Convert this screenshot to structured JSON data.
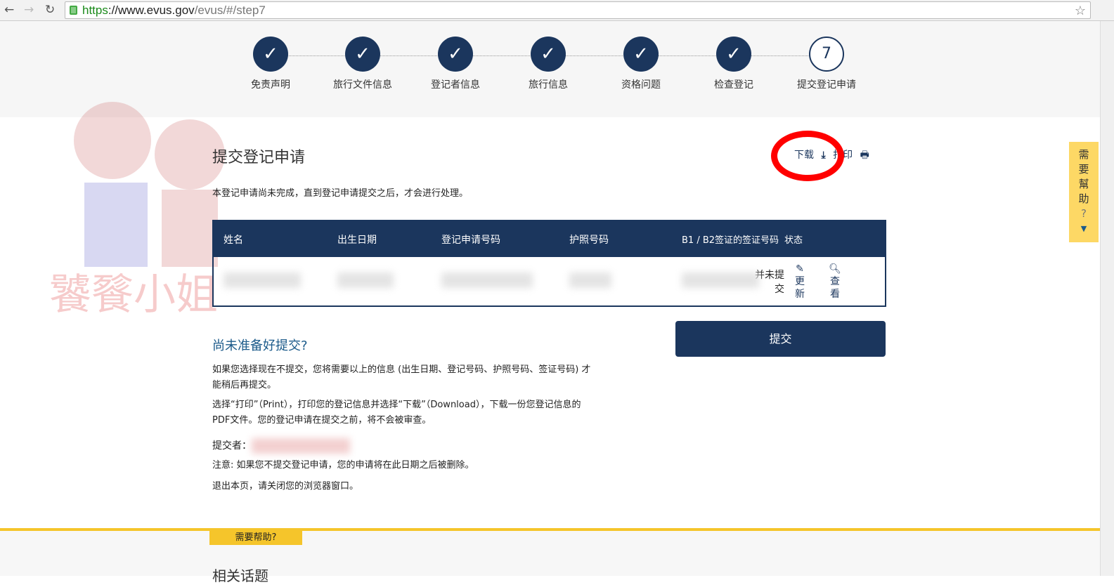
{
  "browser": {
    "url_scheme": "https",
    "url_domain": "://www.evus.gov",
    "url_path": "/evus/#/step7"
  },
  "steps": [
    {
      "label": "免责声明",
      "mark": "✓"
    },
    {
      "label": "旅行文件信息",
      "mark": "✓"
    },
    {
      "label": "登记者信息",
      "mark": "✓"
    },
    {
      "label": "旅行信息",
      "mark": "✓"
    },
    {
      "label": "资格问题",
      "mark": "✓"
    },
    {
      "label": "检查登记",
      "mark": "✓"
    },
    {
      "label": "提交登记申请",
      "mark": "7"
    }
  ],
  "page": {
    "title": "提交登记申请",
    "download": "下载",
    "print": "打印",
    "notice": "本登记申请尚未完成，直到登记申请提交之后，才会进行处理。"
  },
  "table": {
    "headers": [
      "姓名",
      "出生日期",
      "登记申请号码",
      "护照号码",
      "B1 / B2签证的签证号码",
      "状态"
    ],
    "status": "并未提交",
    "update": "更新",
    "view": "查看"
  },
  "submit": "提交",
  "not_ready": {
    "title": "尚未准备好提交?",
    "p1": "如果您选择现在不提交，您将需要以上的信息 (出生日期、登记号码、护照号码、签证号码) 才能稍后再提交。",
    "p2": "选择“打印”（Print），打印您的登记信息并选择“下载”（Download），下载一份您登记信息的PDF文件。您的登记申请在提交之前，将不会被审查。",
    "submitter_label": "提交者：",
    "p3": "注意: 如果您不提交登记申请，您的申请将在此日期之后被删除。",
    "p4": "退出本页，请关闭您的浏览器窗口。"
  },
  "help_tab": {
    "label": "需要幫助",
    "q": "?",
    "arrow": "▼"
  },
  "footer": {
    "help": "需要帮助?",
    "title": "相关话题"
  },
  "colors": {
    "navy": "#1b365d",
    "yellow": "#f5c52b"
  }
}
